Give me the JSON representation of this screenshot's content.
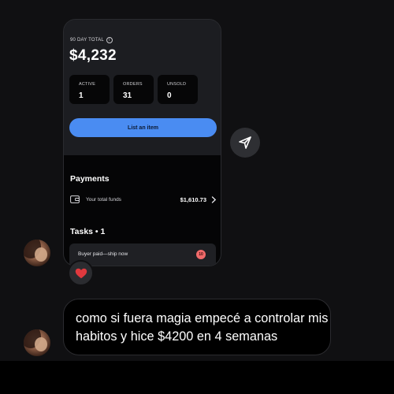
{
  "phone": {
    "period_label": "90 DAY TOTAL",
    "info_icon": "i",
    "total": "$4,232",
    "stats": [
      {
        "label": "ACTIVE",
        "value": "1"
      },
      {
        "label": "ORDERS",
        "value": "31"
      },
      {
        "label": "UNSOLD",
        "value": "0"
      }
    ],
    "list_button": "List an item",
    "payments": {
      "title": "Payments",
      "funds_label": "Your total funds",
      "funds_value": "$1,610.73"
    },
    "tasks": {
      "title": "Tasks • 1",
      "task_label": "Buyer paid—ship now",
      "task_badge": "10"
    }
  },
  "chat": {
    "reaction": "heart",
    "message": "como si fuera magia empecé a controlar mis habitos y hice $4200 en 4 semanas"
  },
  "colors": {
    "accent": "#4a8cf2",
    "badge": "#f06a6a",
    "heart": "#e0393e",
    "background": "#101012"
  },
  "icons": [
    "info-icon",
    "wallet-icon",
    "chevron-right-icon",
    "share-icon",
    "heart-icon"
  ]
}
